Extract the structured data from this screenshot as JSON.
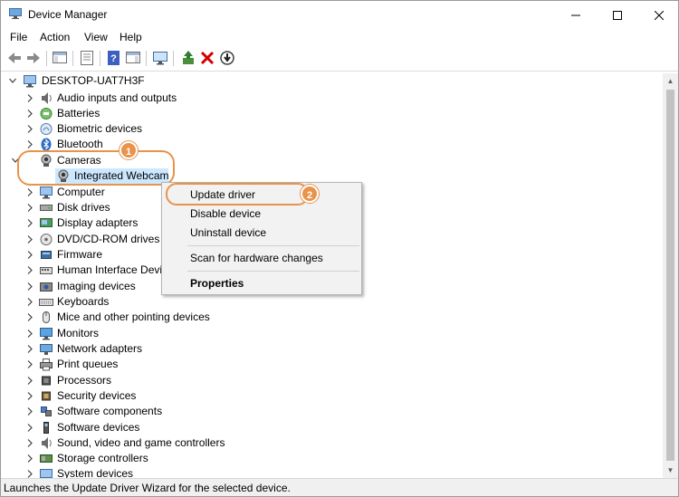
{
  "window": {
    "title": "Device Manager"
  },
  "menu": [
    "File",
    "Action",
    "View",
    "Help"
  ],
  "toolbar": {
    "buttons": [
      "back-arrow-icon",
      "forward-arrow-icon",
      "show-hide-console-tree-icon",
      "properties-icon",
      "help-icon",
      "action-pane-icon",
      "monitor-scan-icon",
      "update-driver-icon",
      "uninstall-icon",
      "download-icon"
    ]
  },
  "tree": {
    "root": "DESKTOP-UAT7H3F",
    "categories": [
      "Audio inputs and outputs",
      "Batteries",
      "Biometric devices",
      "Bluetooth",
      "Cameras",
      "Integrated Webcam",
      "Computer",
      "Disk drives",
      "Display adapters",
      "DVD/CD-ROM drives",
      "Firmware",
      "Human Interface Devic",
      "Imaging devices",
      "Keyboards",
      "Mice and other pointing devices",
      "Monitors",
      "Network adapters",
      "Print queues",
      "Processors",
      "Security devices",
      "Software components",
      "Software devices",
      "Sound, video and game controllers",
      "Storage controllers",
      "System devices"
    ]
  },
  "callouts": {
    "one": "1",
    "two": "2"
  },
  "context_menu": {
    "update": "Update driver",
    "disable": "Disable device",
    "uninstall": "Uninstall device",
    "scan": "Scan for hardware changes",
    "properties": "Properties"
  },
  "status": "Launches the Update Driver Wizard for the selected device.",
  "colors": {
    "accent": "#e8934b",
    "selection": "#cce8ff"
  }
}
